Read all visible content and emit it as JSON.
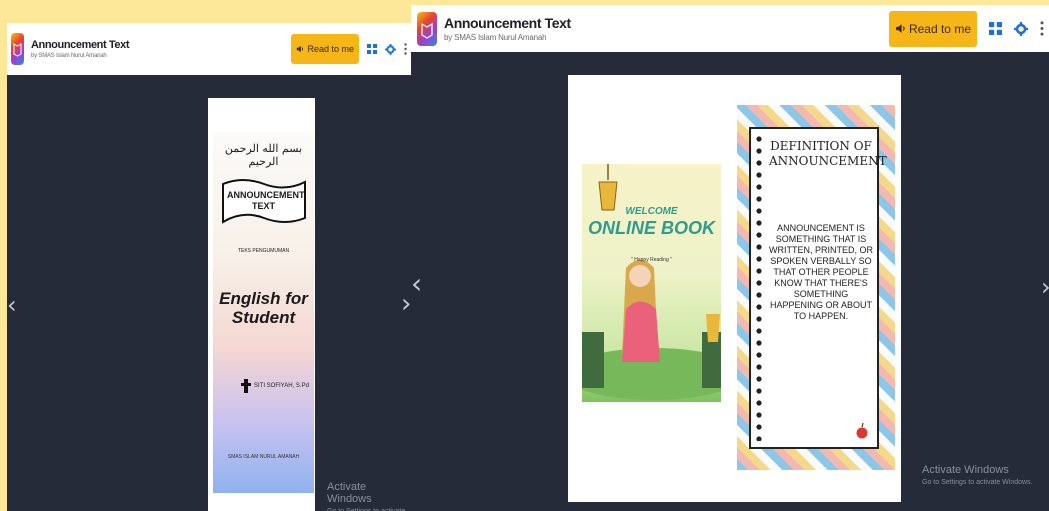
{
  "app": {
    "title": "Announcement Text",
    "author": "by SMAS Islam Nurul Amanah",
    "read_label": "Read to me"
  },
  "icons": {
    "speaker": "speaker-icon",
    "grid": "grid-icon",
    "settings": "gear-icon",
    "more": "more-vertical-icon",
    "prev": "chevron-left-icon",
    "next": "chevron-right-icon"
  },
  "colors": {
    "accent": "#f7b617",
    "viewer_bg": "#252b38",
    "page_bg": "#fde89a",
    "icon_blue": "#1f6fd6"
  },
  "cover": {
    "bismillah": "بسم الله الرحمن الرحيم",
    "banner": "ANNOUNCEMENT TEXT",
    "grade": "TEKS PENGUMUMAN",
    "heading": "English for Student",
    "author": "SITI SOFIYAH, S.Pd",
    "school": "SMAS ISLAM NURUL AMANAH"
  },
  "welcome": {
    "line1": "WELCOME",
    "line2": "ONLINE BOOK",
    "tagline": "\" Happy Reading \""
  },
  "definition": {
    "title": "DEFINITION OF ANNOUNCEMENT",
    "body": "ANNOUNCEMENT IS SOMETHING THAT IS WRITTEN, PRINTED, OR SPOKEN VERBALLY SO THAT OTHER PEOPLE KNOW THAT THERE'S SOMETHING HAPPENING OR ABOUT TO HAPPEN."
  },
  "watermark": {
    "title": "Activate Windows",
    "subtitle": "Go to Settings to activate Windows."
  },
  "nav": {
    "prev": "‹",
    "next": "›"
  }
}
